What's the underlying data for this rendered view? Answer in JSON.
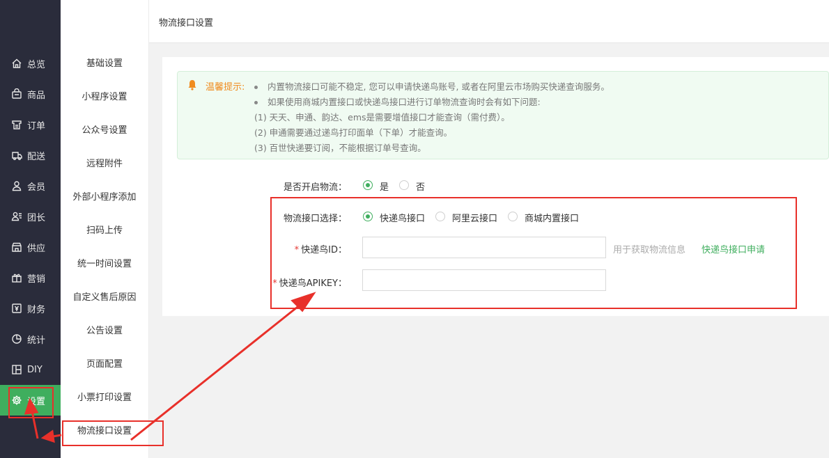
{
  "primary_nav": [
    {
      "label": "总览",
      "icon": "home-icon"
    },
    {
      "label": "商品",
      "icon": "bag-icon"
    },
    {
      "label": "订单",
      "icon": "order-icon"
    },
    {
      "label": "配送",
      "icon": "delivery-icon"
    },
    {
      "label": "会员",
      "icon": "user-icon"
    },
    {
      "label": "团长",
      "icon": "leader-icon"
    },
    {
      "label": "供应",
      "icon": "supply-icon"
    },
    {
      "label": "营销",
      "icon": "gift-icon"
    },
    {
      "label": "财务",
      "icon": "finance-icon"
    },
    {
      "label": "统计",
      "icon": "pie-chart-icon"
    },
    {
      "label": "DIY",
      "icon": "layout-icon"
    },
    {
      "label": "设置",
      "icon": "gear-icon",
      "active": true
    }
  ],
  "secondary_nav": [
    "基础设置",
    "小程序设置",
    "公众号设置",
    "远程附件",
    "外部小程序添加",
    "扫码上传",
    "统一时间设置",
    "自定义售后原因",
    "公告设置",
    "页面配置",
    "小票打印设置",
    "物流接口设置"
  ],
  "header": {
    "title": "物流接口设置"
  },
  "tips": {
    "label": "温馨提示:",
    "items": [
      "内置物流接口可能不稳定, 您可以申请快递鸟账号, 或者在阿里云市场购买快递查询服务。",
      "如果使用商城内置接口或快递鸟接口进行订单物流查询时会有如下问题:"
    ],
    "notes": [
      "(1) 天天、申通、韵达、ems是需要增值接口才能查询（需付费）。",
      "(2) 申通需要通过递鸟打印面单（下单）才能查询。",
      "(3) 百世快递要订阅，不能根据订单号查询。"
    ]
  },
  "form": {
    "enable_label": "是否开启物流：",
    "enable_options": [
      "是",
      "否"
    ],
    "enable_selected": "是",
    "provider_label": "物流接口选择：",
    "provider_options": [
      "快递鸟接口",
      "阿里云接口",
      "商城内置接口"
    ],
    "provider_selected": "快递鸟接口",
    "required_mark": "*",
    "kdn_id_label": "快递鸟ID：",
    "kdn_id_value": "",
    "kdn_id_hint": "用于获取物流信息",
    "kdn_apply_link": "快递鸟接口申请",
    "kdn_key_label": "快递鸟APIKEY：",
    "kdn_key_value": ""
  },
  "colors": {
    "accent": "#3fae5e",
    "sidebar_bg": "#2a2c3b",
    "annotation": "#e8302a",
    "warning": "#f08c1f"
  }
}
